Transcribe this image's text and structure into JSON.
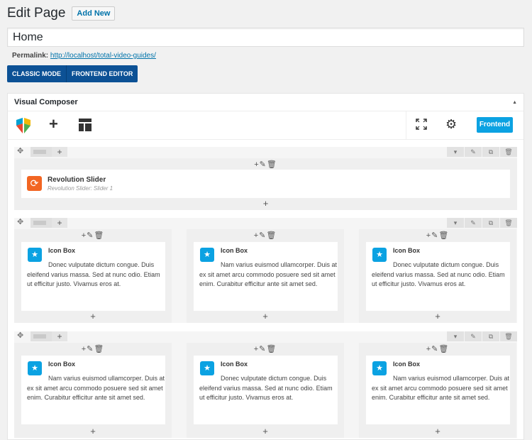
{
  "header": {
    "title": "Edit Page",
    "add_new": "Add New"
  },
  "post_title": "Home",
  "permalink": {
    "label": "Permalink:",
    "url": "http://localhost/total-video-guides/"
  },
  "mode_buttons": {
    "classic": "CLASSIC MODE",
    "frontend": "FRONTEND EDITOR"
  },
  "vc": {
    "title": "Visual Composer",
    "toggle": "▲",
    "frontend_button": "Frontend"
  },
  "icons": {
    "add": "+",
    "gear": "⚙",
    "move": "✥",
    "row_controls": [
      "▾",
      "✎",
      "⧉",
      "🗑"
    ],
    "col_tools": "+✎🗑",
    "refresh": "⟳",
    "star": "★"
  },
  "rows": [
    {
      "element": {
        "name": "Revolution Slider",
        "sub": "Revolution Slider: Slider 1"
      }
    },
    {
      "columns": [
        {
          "title": "Icon Box",
          "text": "Donec vulputate dictum congue. Duis eleifend varius massa. Sed at nunc odio. Etiam ut efficitur justo. Vivamus eros at."
        },
        {
          "title": "Icon Box",
          "text": "Nam varius euismod ullamcorper. Duis at ex sit amet arcu commodo posuere sed sit amet enim. Curabitur efficitur ante sit amet sed."
        },
        {
          "title": "Icon Box",
          "text": "Donec vulputate dictum congue. Duis eleifend varius massa. Sed at nunc odio. Etiam ut efficitur justo. Vivamus eros at."
        }
      ]
    },
    {
      "columns": [
        {
          "title": "Icon Box",
          "text": "Nam varius euismod ullamcorper. Duis at ex sit amet arcu commodo posuere sed sit amet enim. Curabitur efficitur ante sit amet sed."
        },
        {
          "title": "Icon Box",
          "text": "Donec vulputate dictum congue. Duis eleifend varius massa. Sed at nunc odio. Etiam ut efficitur justo. Vivamus eros at."
        },
        {
          "title": "Icon Box",
          "text": "Nam varius euismod ullamcorper. Duis at ex sit amet arcu commodo posuere sed sit amet enim. Curabitur efficitur ante sit amet sed."
        }
      ]
    }
  ]
}
